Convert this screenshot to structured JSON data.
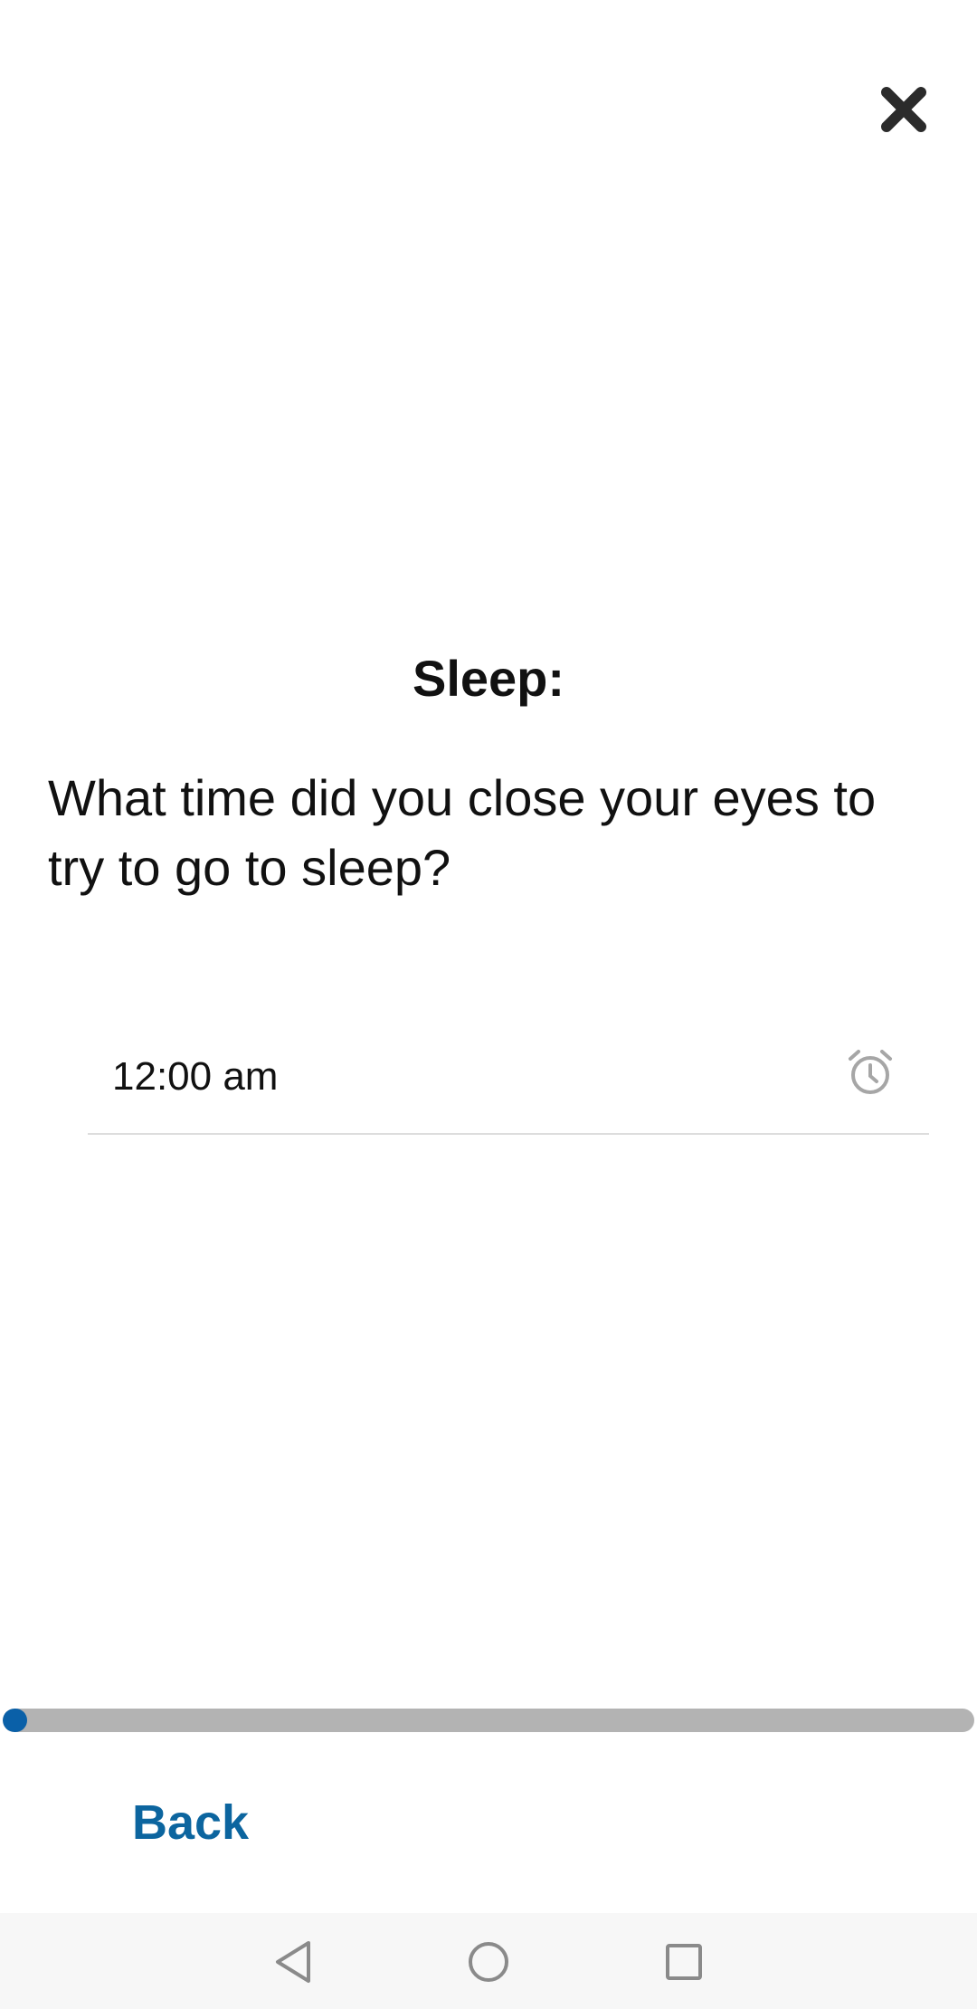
{
  "header": {
    "close_icon": "close-icon"
  },
  "survey": {
    "section_title": "Sleep:",
    "question": "What time did you close your eyes to try to go to sleep?",
    "time_value": "12:00 am",
    "time_icon": "alarm-clock-icon"
  },
  "progress": {
    "fraction": 0.025,
    "fill_color": "#0a60a8",
    "track_color": "#b3b3b3"
  },
  "footer": {
    "back_label": "Back",
    "back_color": "#0c659f"
  },
  "nav_bar": {
    "icons": [
      "back-triangle-icon",
      "home-circle-icon",
      "recents-square-icon"
    ]
  }
}
